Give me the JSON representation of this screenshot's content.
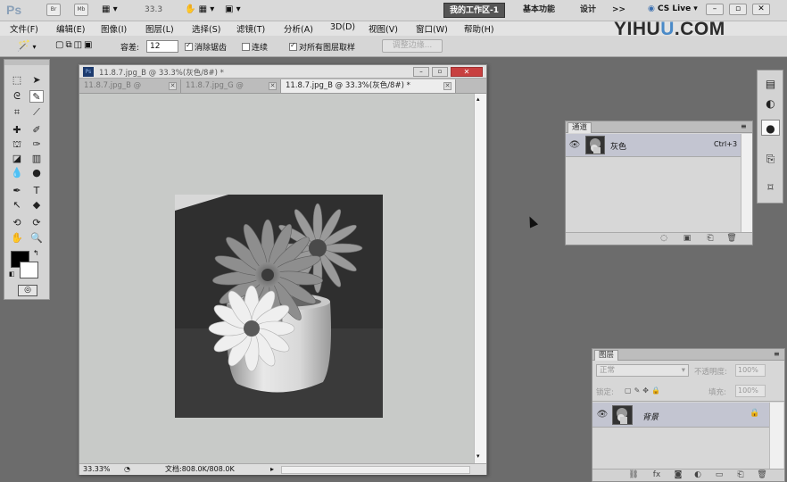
{
  "app": {
    "logo": "Ps",
    "icon_labels": [
      "Br",
      "Mb"
    ],
    "zoom_field": "33.3",
    "workspaces": [
      "我的工作区-1",
      "基本功能",
      "设计"
    ],
    "more_label": ">>",
    "cs_live": "CS Live ▾",
    "window_controls": [
      "–",
      "▫",
      "✕"
    ]
  },
  "menu": {
    "items": [
      "文件(F)",
      "编辑(E)",
      "图像(I)",
      "图层(L)",
      "选择(S)",
      "滤镜(T)",
      "分析(A)",
      "3D(D)",
      "视图(V)",
      "窗口(W)",
      "帮助(H)"
    ]
  },
  "watermark": {
    "pre": "YIHU",
    "u": "U",
    "post": ".COM"
  },
  "options": {
    "tolerance_label": "容差:",
    "tolerance_value": "12",
    "antialias_label": "消除锯齿",
    "antialias_checked": true,
    "contiguous_label": "连续",
    "contiguous_checked": false,
    "sample_all_label": "对所有图层取样",
    "sample_all_checked": true,
    "refine_edge_label": "调整边缘..."
  },
  "document": {
    "title": "11.8.7.jpg_B @ 33.3%(灰色/8#) *",
    "tabs": [
      {
        "label": "11.8.7.jpg_B @",
        "active": false
      },
      {
        "label": "11.8.7.jpg_G @",
        "active": false
      },
      {
        "label": "11.8.7.jpg_B @ 33.3%(灰色/8#) *",
        "active": true
      }
    ],
    "zoom": "33.33%",
    "doc_info": "文档:808.0K/808.0K"
  },
  "channels_panel": {
    "tab": "通道",
    "menu_icon": "≡",
    "rows": [
      {
        "name": "灰色",
        "shortcut": "Ctrl+3",
        "visible": true
      }
    ]
  },
  "layers_panel": {
    "tab": "图层",
    "blend_mode": "正常",
    "opacity_label": "不透明度:",
    "opacity_value": "100%",
    "lock_label": "锁定:",
    "fill_label": "填充:",
    "fill_value": "100%",
    "rows": [
      {
        "name": "背景",
        "visible": true
      }
    ]
  },
  "colors": {
    "foreground": "#000000",
    "background": "#ffffff",
    "workspace": "#6c6c6c",
    "active_workspace_btn": "#555555"
  },
  "icons": [
    "marquee-icon",
    "move-icon",
    "lasso-icon",
    "quick-select-icon",
    "crop-icon",
    "eyedropper-icon",
    "healing-icon",
    "brush-icon",
    "stamp-icon",
    "history-brush-icon",
    "eraser-icon",
    "gradient-icon",
    "blur-icon",
    "dodge-icon",
    "pen-icon",
    "type-icon",
    "path-select-icon",
    "shape-icon",
    "3d-rotate-icon",
    "3d-orbit-icon",
    "hand-icon",
    "zoom-icon",
    "quick-mask-icon"
  ]
}
